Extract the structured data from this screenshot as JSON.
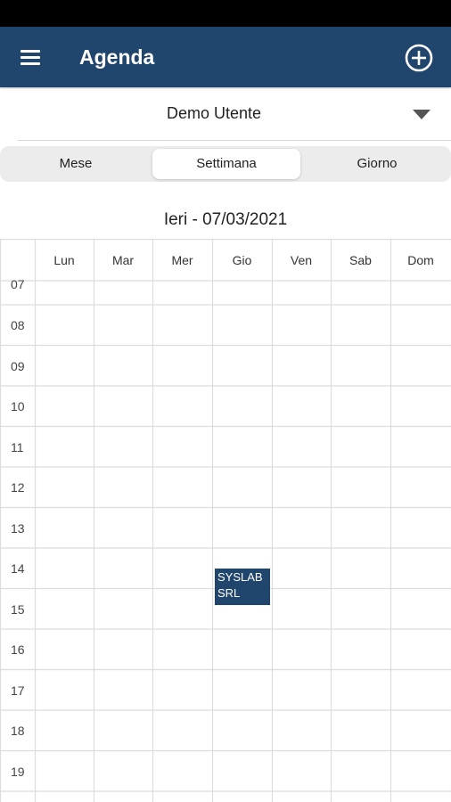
{
  "header": {
    "title": "Agenda",
    "menu_icon": "menu-icon",
    "add_icon": "add-circle-icon",
    "color": "#21466d"
  },
  "user_select": {
    "value": "Demo Utente"
  },
  "view_tabs": [
    {
      "label": "Mese",
      "active": false
    },
    {
      "label": "Settimana",
      "active": true
    },
    {
      "label": "Giorno",
      "active": false
    }
  ],
  "date_label": "Ieri - 07/03/2021",
  "days": [
    "Lun",
    "Mar",
    "Mer",
    "Gio",
    "Ven",
    "Sab",
    "Dom"
  ],
  "hours": [
    "07",
    "08",
    "09",
    "10",
    "11",
    "12",
    "13",
    "14",
    "15",
    "16",
    "17",
    "18",
    "19"
  ],
  "events": [
    {
      "title": "SYSLAB SRL",
      "day": "Gio",
      "start_hour": 14.5,
      "end_hour": 15.5
    }
  ]
}
